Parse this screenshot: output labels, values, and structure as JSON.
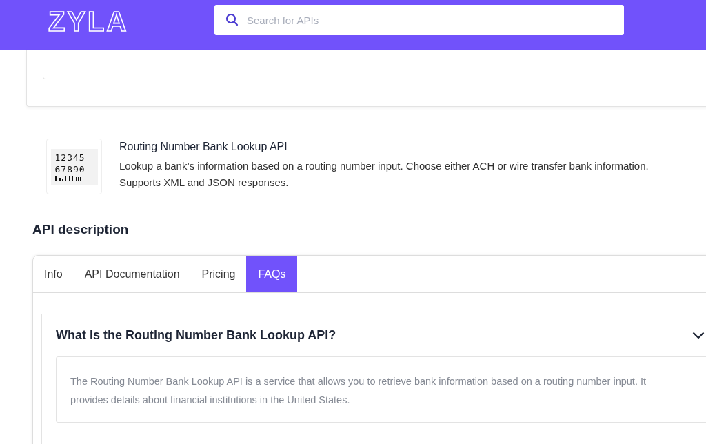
{
  "header": {
    "logo": "ZYLA",
    "search": {
      "placeholder": "Search for APIs"
    }
  },
  "api": {
    "logo_lines": [
      "12345",
      "67890"
    ],
    "title": "Routing Number Bank Lookup API",
    "description": "Lookup a bank’s information based on a routing number input. Choose either ACH or wire transfer bank information. Supports XML and JSON responses."
  },
  "section_title": "API description",
  "tabs": [
    {
      "label": "Info",
      "selected": false
    },
    {
      "label": "API Documentation",
      "selected": false
    },
    {
      "label": "Pricing",
      "selected": false
    },
    {
      "label": "FAQs",
      "selected": true
    }
  ],
  "faqs": [
    {
      "question": "What is the Routing Number Bank Lookup API?",
      "expanded": true,
      "answer": "The Routing Number Bank Lookup API is a service that allows you to retrieve bank information based on a routing number input. It provides details about financial institutions in the United States."
    }
  ]
}
